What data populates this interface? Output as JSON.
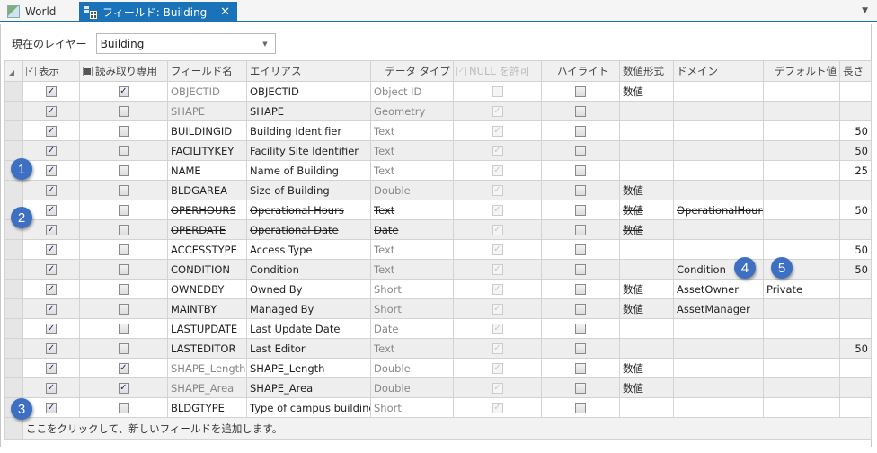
{
  "tabs": [
    {
      "label": "World",
      "icon": "map-icon",
      "active": false
    },
    {
      "label": "フィールド: Building",
      "icon": "table-fields-icon",
      "active": true
    }
  ],
  "layer": {
    "label": "現在のレイヤー",
    "value": "Building"
  },
  "columns": {
    "visible": "表示",
    "readonly": "読み取り専用",
    "field_name": "フィールド名",
    "alias": "エイリアス",
    "data_type": "データ タイプ",
    "allow_null": "NULL を許可",
    "highlight": "ハイライト",
    "number_format": "数値形式",
    "domain": "ドメイン",
    "default": "デフォルト値",
    "length": "長さ"
  },
  "rows": [
    {
      "name": "OBJECTID",
      "alias": "OBJECTID",
      "type": "Object ID",
      "visible": true,
      "readonly": true,
      "null": false,
      "highlight": false,
      "format": "数値",
      "domain": "",
      "default": "",
      "length": "",
      "system": true,
      "deleted": false
    },
    {
      "name": "SHAPE",
      "alias": "SHAPE",
      "type": "Geometry",
      "visible": true,
      "readonly": false,
      "null": true,
      "highlight": false,
      "format": "",
      "domain": "",
      "default": "",
      "length": "",
      "system": true,
      "deleted": false
    },
    {
      "name": "BUILDINGID",
      "alias": "Building Identifier",
      "type": "Text",
      "visible": true,
      "readonly": false,
      "null": true,
      "highlight": false,
      "format": "",
      "domain": "",
      "default": "",
      "length": "50",
      "system": false,
      "deleted": false
    },
    {
      "name": "FACILITYKEY",
      "alias": "Facility Site Identifier",
      "type": "Text",
      "visible": true,
      "readonly": false,
      "null": true,
      "highlight": false,
      "format": "",
      "domain": "",
      "default": "",
      "length": "50",
      "system": false,
      "deleted": false
    },
    {
      "name": "NAME",
      "alias": "Name of Building",
      "type": "Text",
      "visible": true,
      "readonly": false,
      "null": true,
      "highlight": false,
      "format": "",
      "domain": "",
      "default": "",
      "length": "25",
      "system": false,
      "deleted": false
    },
    {
      "name": "BLDGAREA",
      "alias": "Size of Building",
      "type": "Double",
      "visible": true,
      "readonly": false,
      "null": true,
      "highlight": false,
      "format": "数値",
      "domain": "",
      "default": "",
      "length": "",
      "system": false,
      "deleted": false
    },
    {
      "name": "OPERHOURS",
      "alias": "Operational Hours",
      "type": "Text",
      "visible": true,
      "readonly": false,
      "null": true,
      "highlight": false,
      "format": "数値",
      "domain": "OperationalHours",
      "default": "",
      "length": "50",
      "system": false,
      "deleted": true
    },
    {
      "name": "OPERDATE",
      "alias": "Operational Date",
      "type": "Date",
      "visible": true,
      "readonly": false,
      "null": true,
      "highlight": false,
      "format": "数値",
      "domain": "",
      "default": "",
      "length": "",
      "system": false,
      "deleted": true
    },
    {
      "name": "ACCESSTYPE",
      "alias": "Access Type",
      "type": "Text",
      "visible": true,
      "readonly": false,
      "null": true,
      "highlight": false,
      "format": "",
      "domain": "",
      "default": "",
      "length": "50",
      "system": false,
      "deleted": false
    },
    {
      "name": "CONDITION",
      "alias": "Condition",
      "type": "Text",
      "visible": true,
      "readonly": false,
      "null": true,
      "highlight": false,
      "format": "",
      "domain": "Condition",
      "default": "",
      "length": "50",
      "system": false,
      "deleted": false
    },
    {
      "name": "OWNEDBY",
      "alias": "Owned By",
      "type": "Short",
      "visible": true,
      "readonly": false,
      "null": true,
      "highlight": false,
      "format": "数値",
      "domain": "AssetOwner",
      "default": "Private",
      "length": "",
      "system": false,
      "deleted": false
    },
    {
      "name": "MAINTBY",
      "alias": "Managed By",
      "type": "Short",
      "visible": true,
      "readonly": false,
      "null": true,
      "highlight": false,
      "format": "数値",
      "domain": "AssetManager",
      "default": "",
      "length": "",
      "system": false,
      "deleted": false
    },
    {
      "name": "LASTUPDATE",
      "alias": "Last Update Date",
      "type": "Date",
      "visible": true,
      "readonly": false,
      "null": true,
      "highlight": false,
      "format": "",
      "domain": "",
      "default": "",
      "length": "",
      "system": false,
      "deleted": false
    },
    {
      "name": "LASTEDITOR",
      "alias": "Last Editor",
      "type": "Text",
      "visible": true,
      "readonly": false,
      "null": true,
      "highlight": false,
      "format": "",
      "domain": "",
      "default": "",
      "length": "50",
      "system": false,
      "deleted": false
    },
    {
      "name": "SHAPE_Length",
      "alias": "SHAPE_Length",
      "type": "Double",
      "visible": true,
      "readonly": true,
      "null": true,
      "highlight": false,
      "format": "数値",
      "domain": "",
      "default": "",
      "length": "",
      "system": true,
      "deleted": false
    },
    {
      "name": "SHAPE_Area",
      "alias": "SHAPE_Area",
      "type": "Double",
      "visible": true,
      "readonly": true,
      "null": true,
      "highlight": false,
      "format": "数値",
      "domain": "",
      "default": "",
      "length": "",
      "system": true,
      "deleted": false
    },
    {
      "name": "BLDGTYPE",
      "alias": "Type of campus building",
      "type": "Short",
      "visible": true,
      "readonly": false,
      "null": true,
      "highlight": false,
      "format": "",
      "domain": "",
      "default": "",
      "length": "",
      "system": false,
      "deleted": false
    }
  ],
  "add_field_prompt": "ここをクリックして、新しいフィールドを追加します。",
  "callouts": [
    "1",
    "2",
    "3",
    "4",
    "5"
  ]
}
